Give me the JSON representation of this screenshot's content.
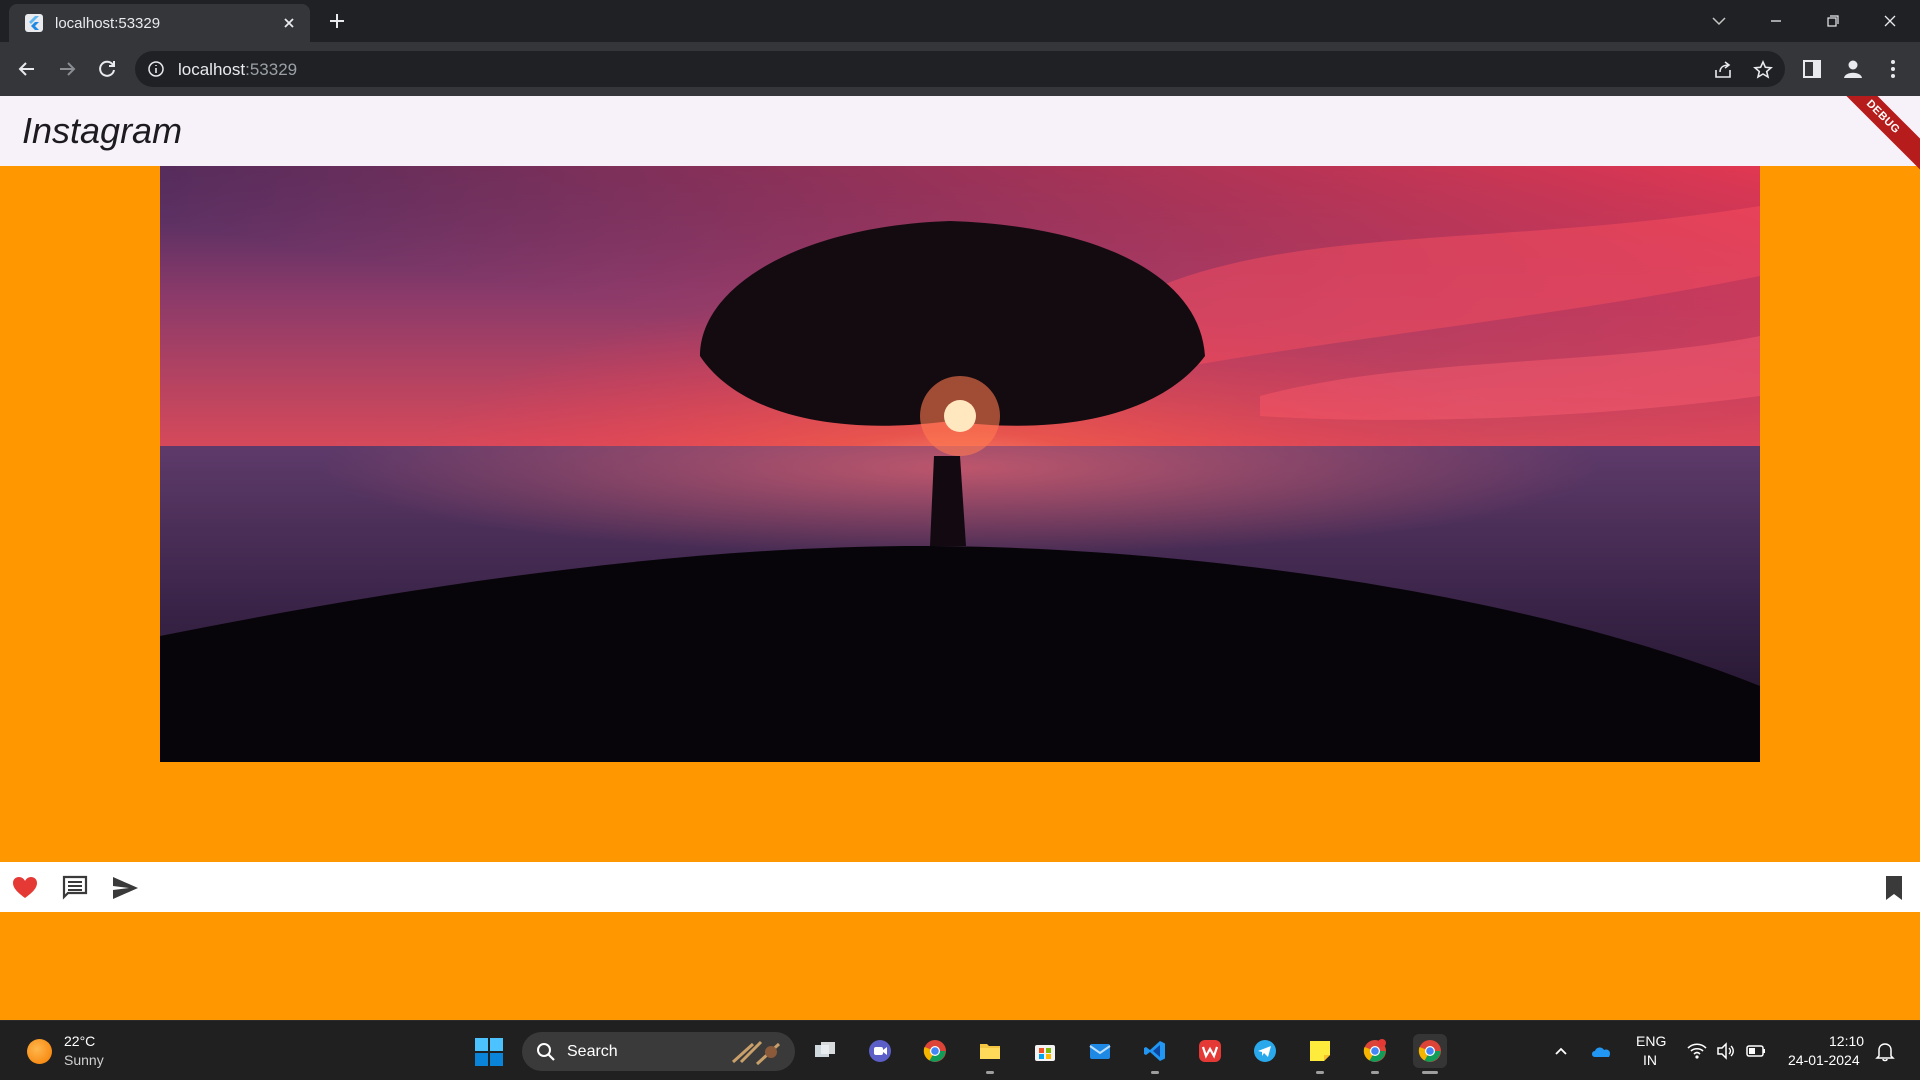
{
  "browser": {
    "tab_title": "localhost:53329",
    "url_host": "localhost",
    "url_port": ":53329",
    "icons": {
      "tab_favicon": "flutter-icon",
      "tab_close": "close-icon",
      "new_tab": "plus-icon",
      "back": "back-arrow-icon",
      "forward": "forward-arrow-icon",
      "reload": "reload-icon",
      "site_info": "info-icon",
      "share": "share-icon",
      "bookmark": "star-icon",
      "side_panel": "side-panel-icon",
      "profile": "profile-icon",
      "menu": "kebab-menu-icon"
    }
  },
  "app": {
    "title": "Instagram",
    "debug_banner": "DEBUG",
    "background_color": "#ff9800",
    "appbar_color": "#f7f2fa",
    "actions": {
      "like": "heart-icon",
      "comment": "comment-icon",
      "share": "send-icon",
      "save": "bookmark-icon"
    },
    "like_color": "#e53935"
  },
  "taskbar": {
    "weather": {
      "temp": "22°C",
      "condition": "Sunny"
    },
    "search_label": "Search",
    "pinned_apps": [
      "task-view",
      "meet",
      "chrome",
      "file-explorer",
      "microsoft-store",
      "mail",
      "vscode",
      "wps-office",
      "telegram",
      "sticky-notes",
      "chrome-profile",
      "chrome-active"
    ],
    "tray": {
      "lang_1": "ENG",
      "lang_2": "IN",
      "time": "12:10",
      "date": "24-01-2024"
    }
  }
}
